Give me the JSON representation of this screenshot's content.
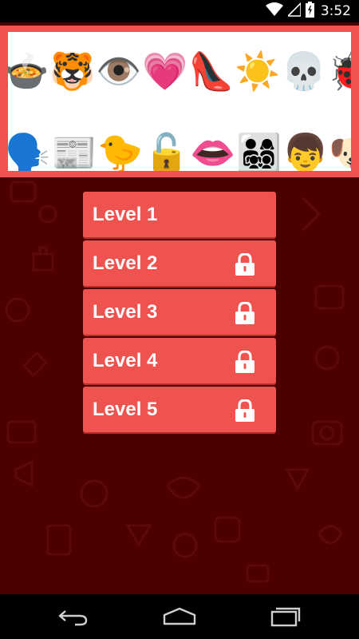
{
  "status": {
    "time": "3:52",
    "icons": [
      "wifi-icon",
      "cellular-icon",
      "battery-charging-icon"
    ]
  },
  "banner": {
    "row1": [
      "🍲",
      "🐯",
      "👁️",
      "💗",
      "👠",
      "☀️",
      "💀",
      "🐞"
    ],
    "row2": [
      "🗣️",
      "📰",
      "🐤",
      "🔓",
      "👄",
      "👨‍👩‍👧‍👦",
      "👦",
      "🐶"
    ]
  },
  "levels": [
    {
      "label": "Level 1",
      "locked": false
    },
    {
      "label": "Level 2",
      "locked": true
    },
    {
      "label": "Level 3",
      "locked": true
    },
    {
      "label": "Level 4",
      "locked": true
    },
    {
      "label": "Level 5",
      "locked": true
    }
  ],
  "nav": [
    "back-icon",
    "home-icon",
    "recent-apps-icon"
  ],
  "colors": {
    "background": "#4e0000",
    "accent": "#ef5350",
    "button_shadow": "#b8302c"
  }
}
